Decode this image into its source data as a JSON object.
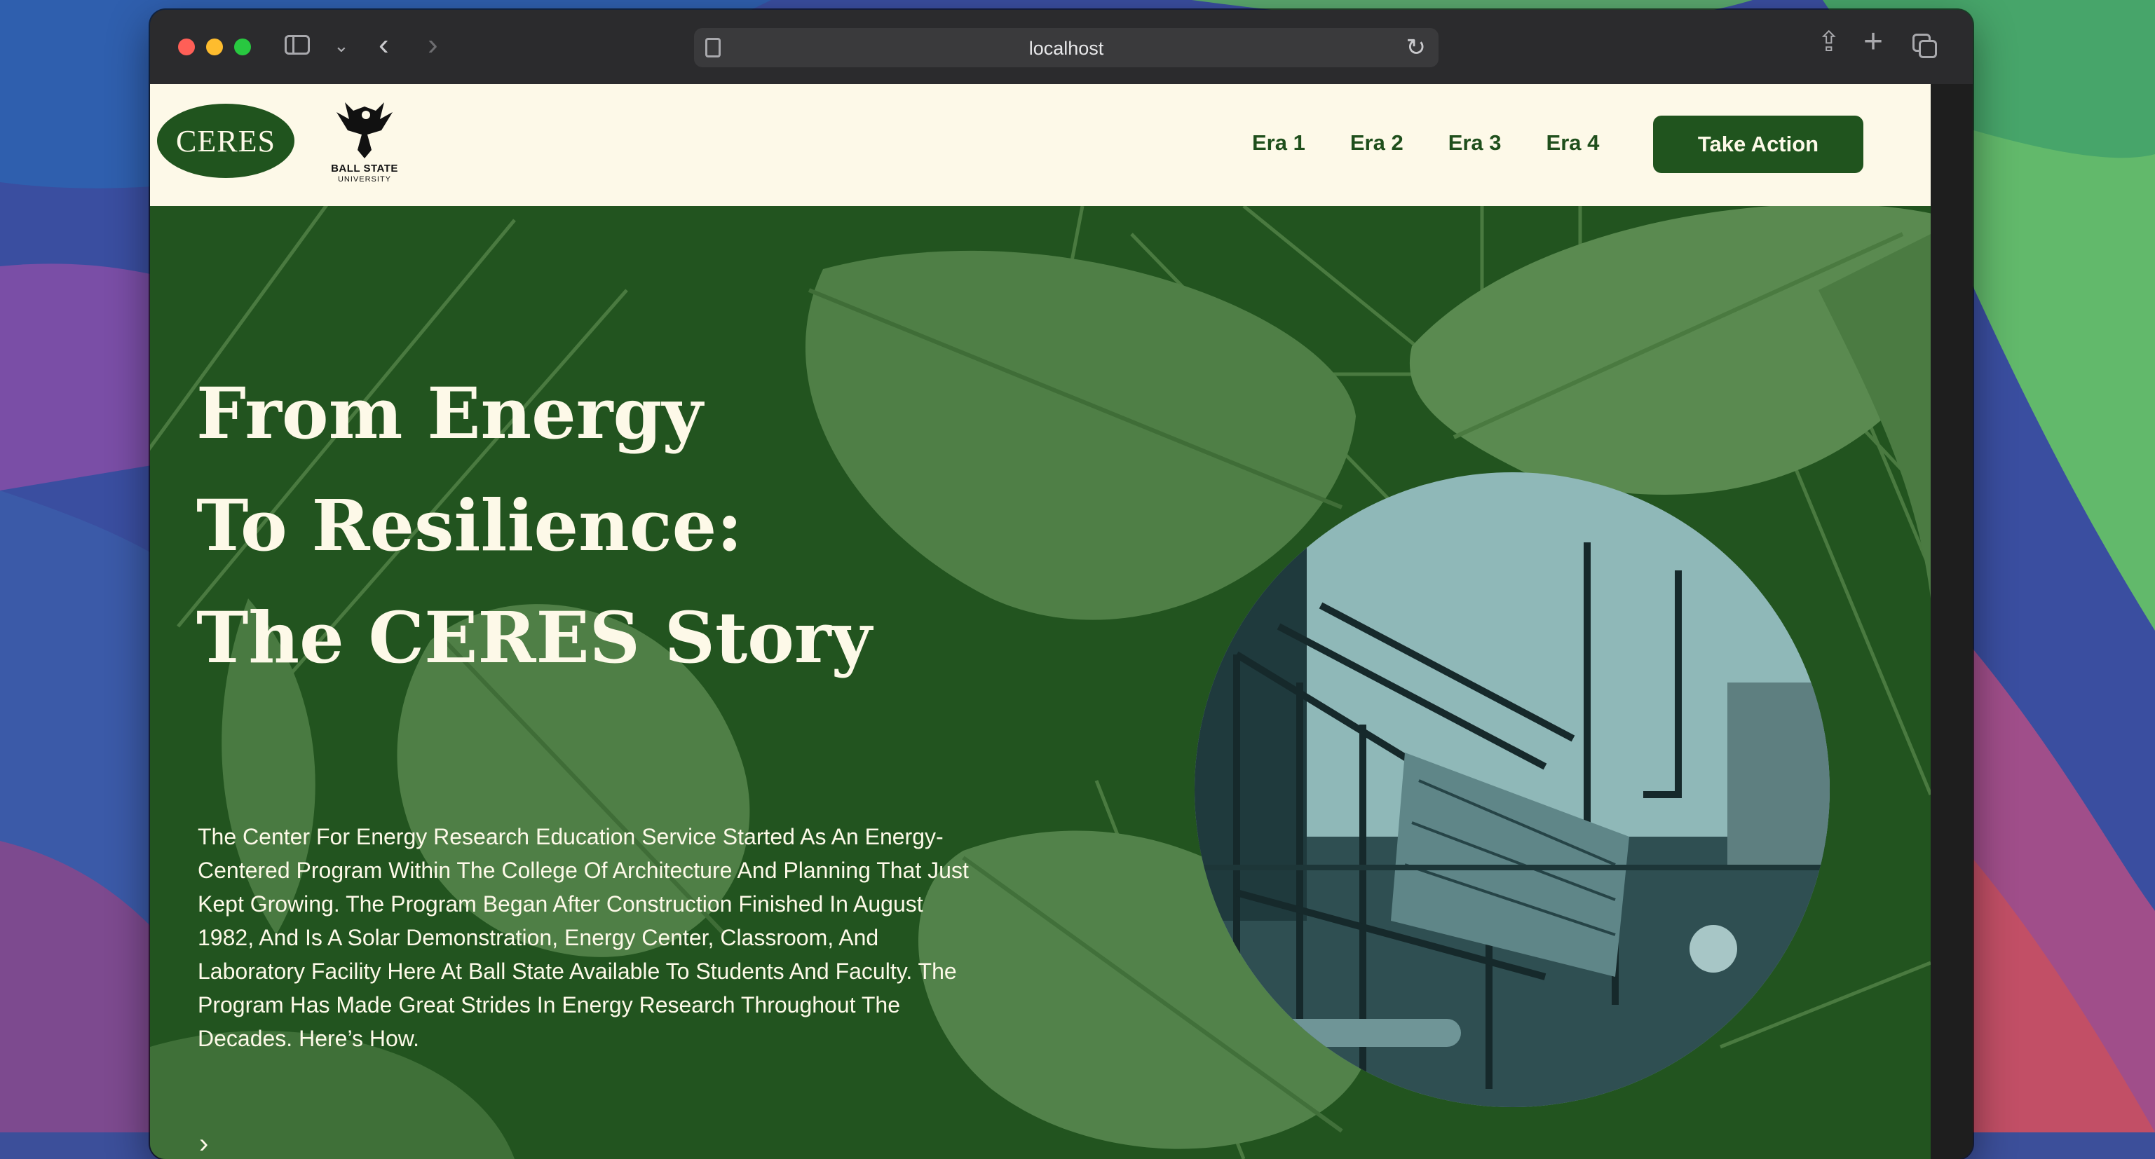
{
  "browser": {
    "url": "localhost",
    "colors": {
      "close": "#ff5f57",
      "minimize": "#febc2e",
      "zoom": "#28c840"
    },
    "icons": [
      "sidebar-icon",
      "chevron-down-icon",
      "back-icon",
      "forward-icon",
      "reader-icon",
      "reload-icon",
      "share-icon",
      "new-tab-icon",
      "tab-overview-icon"
    ]
  },
  "site": {
    "logo_text": "CERES",
    "partner_logo": {
      "name": "BALL STATE",
      "sub": "UNIVERSITY"
    },
    "nav": [
      {
        "label": "Era 1"
      },
      {
        "label": "Era 2"
      },
      {
        "label": "Era 3"
      },
      {
        "label": "Era 4"
      }
    ],
    "cta_label": "Take Action",
    "colors": {
      "primary": "#20541e",
      "cream": "#fdf9e8",
      "leaf": "#4f7f46"
    }
  },
  "hero": {
    "title_lines": [
      "From Energy",
      "To Resilience:",
      "The CERES Story"
    ],
    "body": "The Center For Energy Research Education Service Started As An Energy-Centered Program Within The College Of Architecture And Planning That Just Kept Growing. The Program Began After Construction Finished In August 1982, And Is A Solar Demonstration, Energy Center, Classroom, And Laboratory Facility Here At Ball State Available To Students And Faculty. The Program Has Made Great Strides In Energy Research Throughout The Decades. Here’s How."
  }
}
